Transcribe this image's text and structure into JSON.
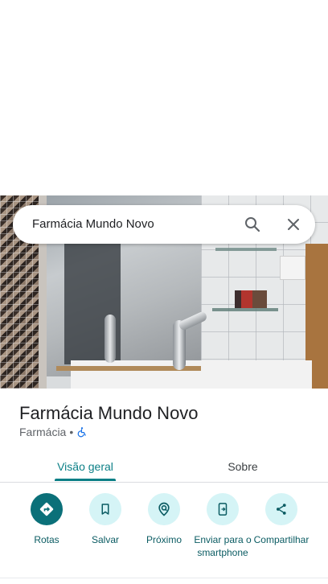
{
  "search": {
    "query": "Farmácia Mundo Novo",
    "search_icon": "search-icon",
    "close_icon": "close-icon"
  },
  "place": {
    "title": "Farmácia Mundo Novo",
    "category": "Farmácia",
    "separator": "•",
    "accessibility_icon": "wheelchair-icon"
  },
  "tabs": [
    {
      "label": "Visão geral",
      "active": true
    },
    {
      "label": "Sobre",
      "active": false
    }
  ],
  "actions": [
    {
      "label": "Rotas",
      "icon": "directions-icon"
    },
    {
      "label": "Salvar",
      "icon": "bookmark-icon"
    },
    {
      "label": "Próximo",
      "icon": "nearby-icon"
    },
    {
      "label": "Enviar para o smartphone",
      "icon": "send-to-phone-icon"
    },
    {
      "label": "Compartilhar",
      "icon": "share-icon"
    }
  ],
  "colors": {
    "accent": "#0b7f86",
    "action_bg": "#d5f4f6",
    "primary_action_bg": "#0b7079",
    "accessibility": "#1a73e8"
  }
}
